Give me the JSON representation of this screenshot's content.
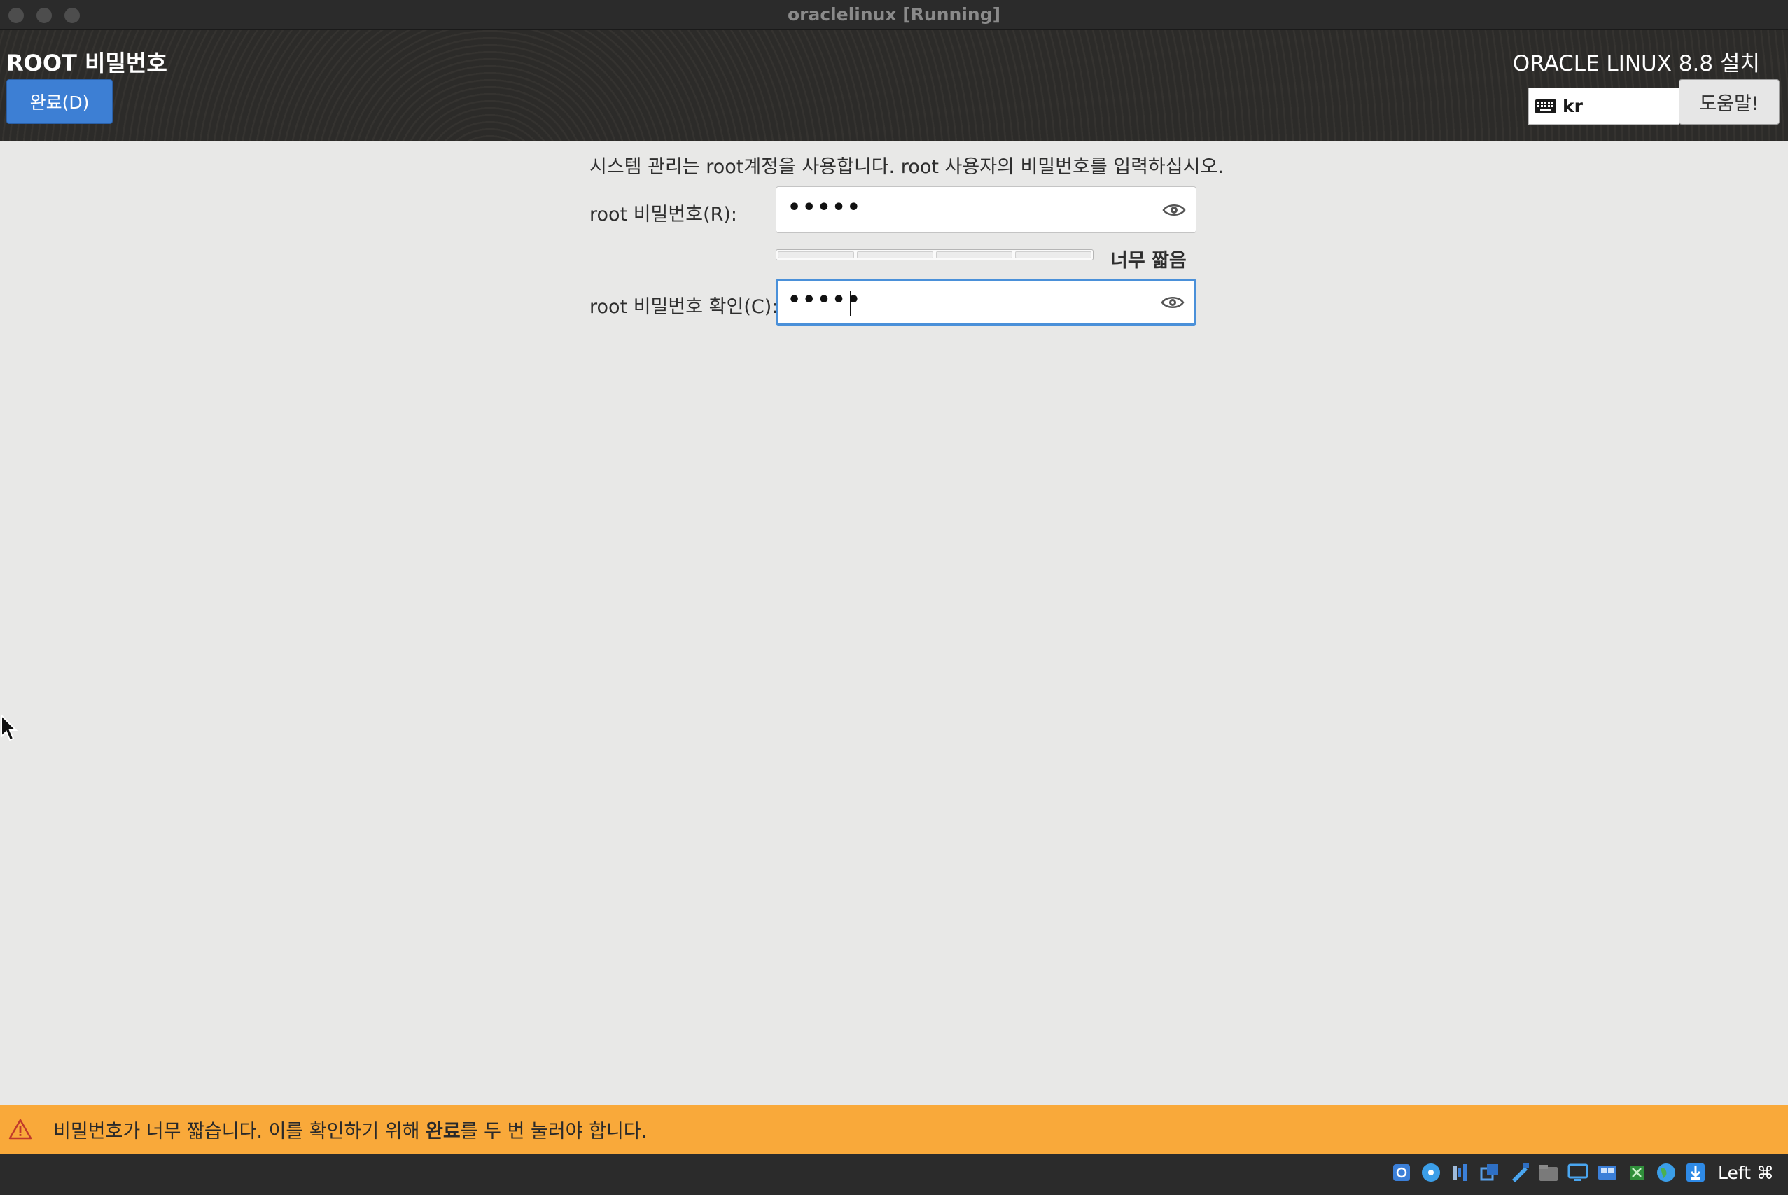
{
  "window": {
    "title": "oraclelinux [Running]"
  },
  "header": {
    "spoke_title": "ROOT 비밀번호",
    "done_button": "완료(D)",
    "product_title": "ORACLE LINUX 8.8 설치",
    "keyboard_layout": "kr",
    "help_button": "도움말!"
  },
  "form": {
    "intro": "시스템 관리는 root계정을 사용합니다. root 사용자의 비밀번호를 입력하십시오.",
    "password_label": "root 비밀번호(R):",
    "password_masked": "•••••",
    "strength_level": 0,
    "strength_text": "너무 짧음",
    "confirm_label": "root 비밀번호 확인(C):",
    "confirm_masked": "•••••"
  },
  "warning": {
    "text_before": "비밀번호가 너무 짧습니다. 이를 확인하기 위해 ",
    "text_bold": "완료",
    "text_after": "를 두 번 눌러야 합니다."
  },
  "statusbar": {
    "host_key": "Left ⌘",
    "icons": [
      "hard-disk-icon",
      "optical-disk-icon",
      "audio-icon",
      "network-icon",
      "usb-icon",
      "shared-folder-icon",
      "display-icon",
      "video-capture-icon",
      "cpu-icon",
      "globe-icon",
      "download-arrow-icon"
    ]
  }
}
